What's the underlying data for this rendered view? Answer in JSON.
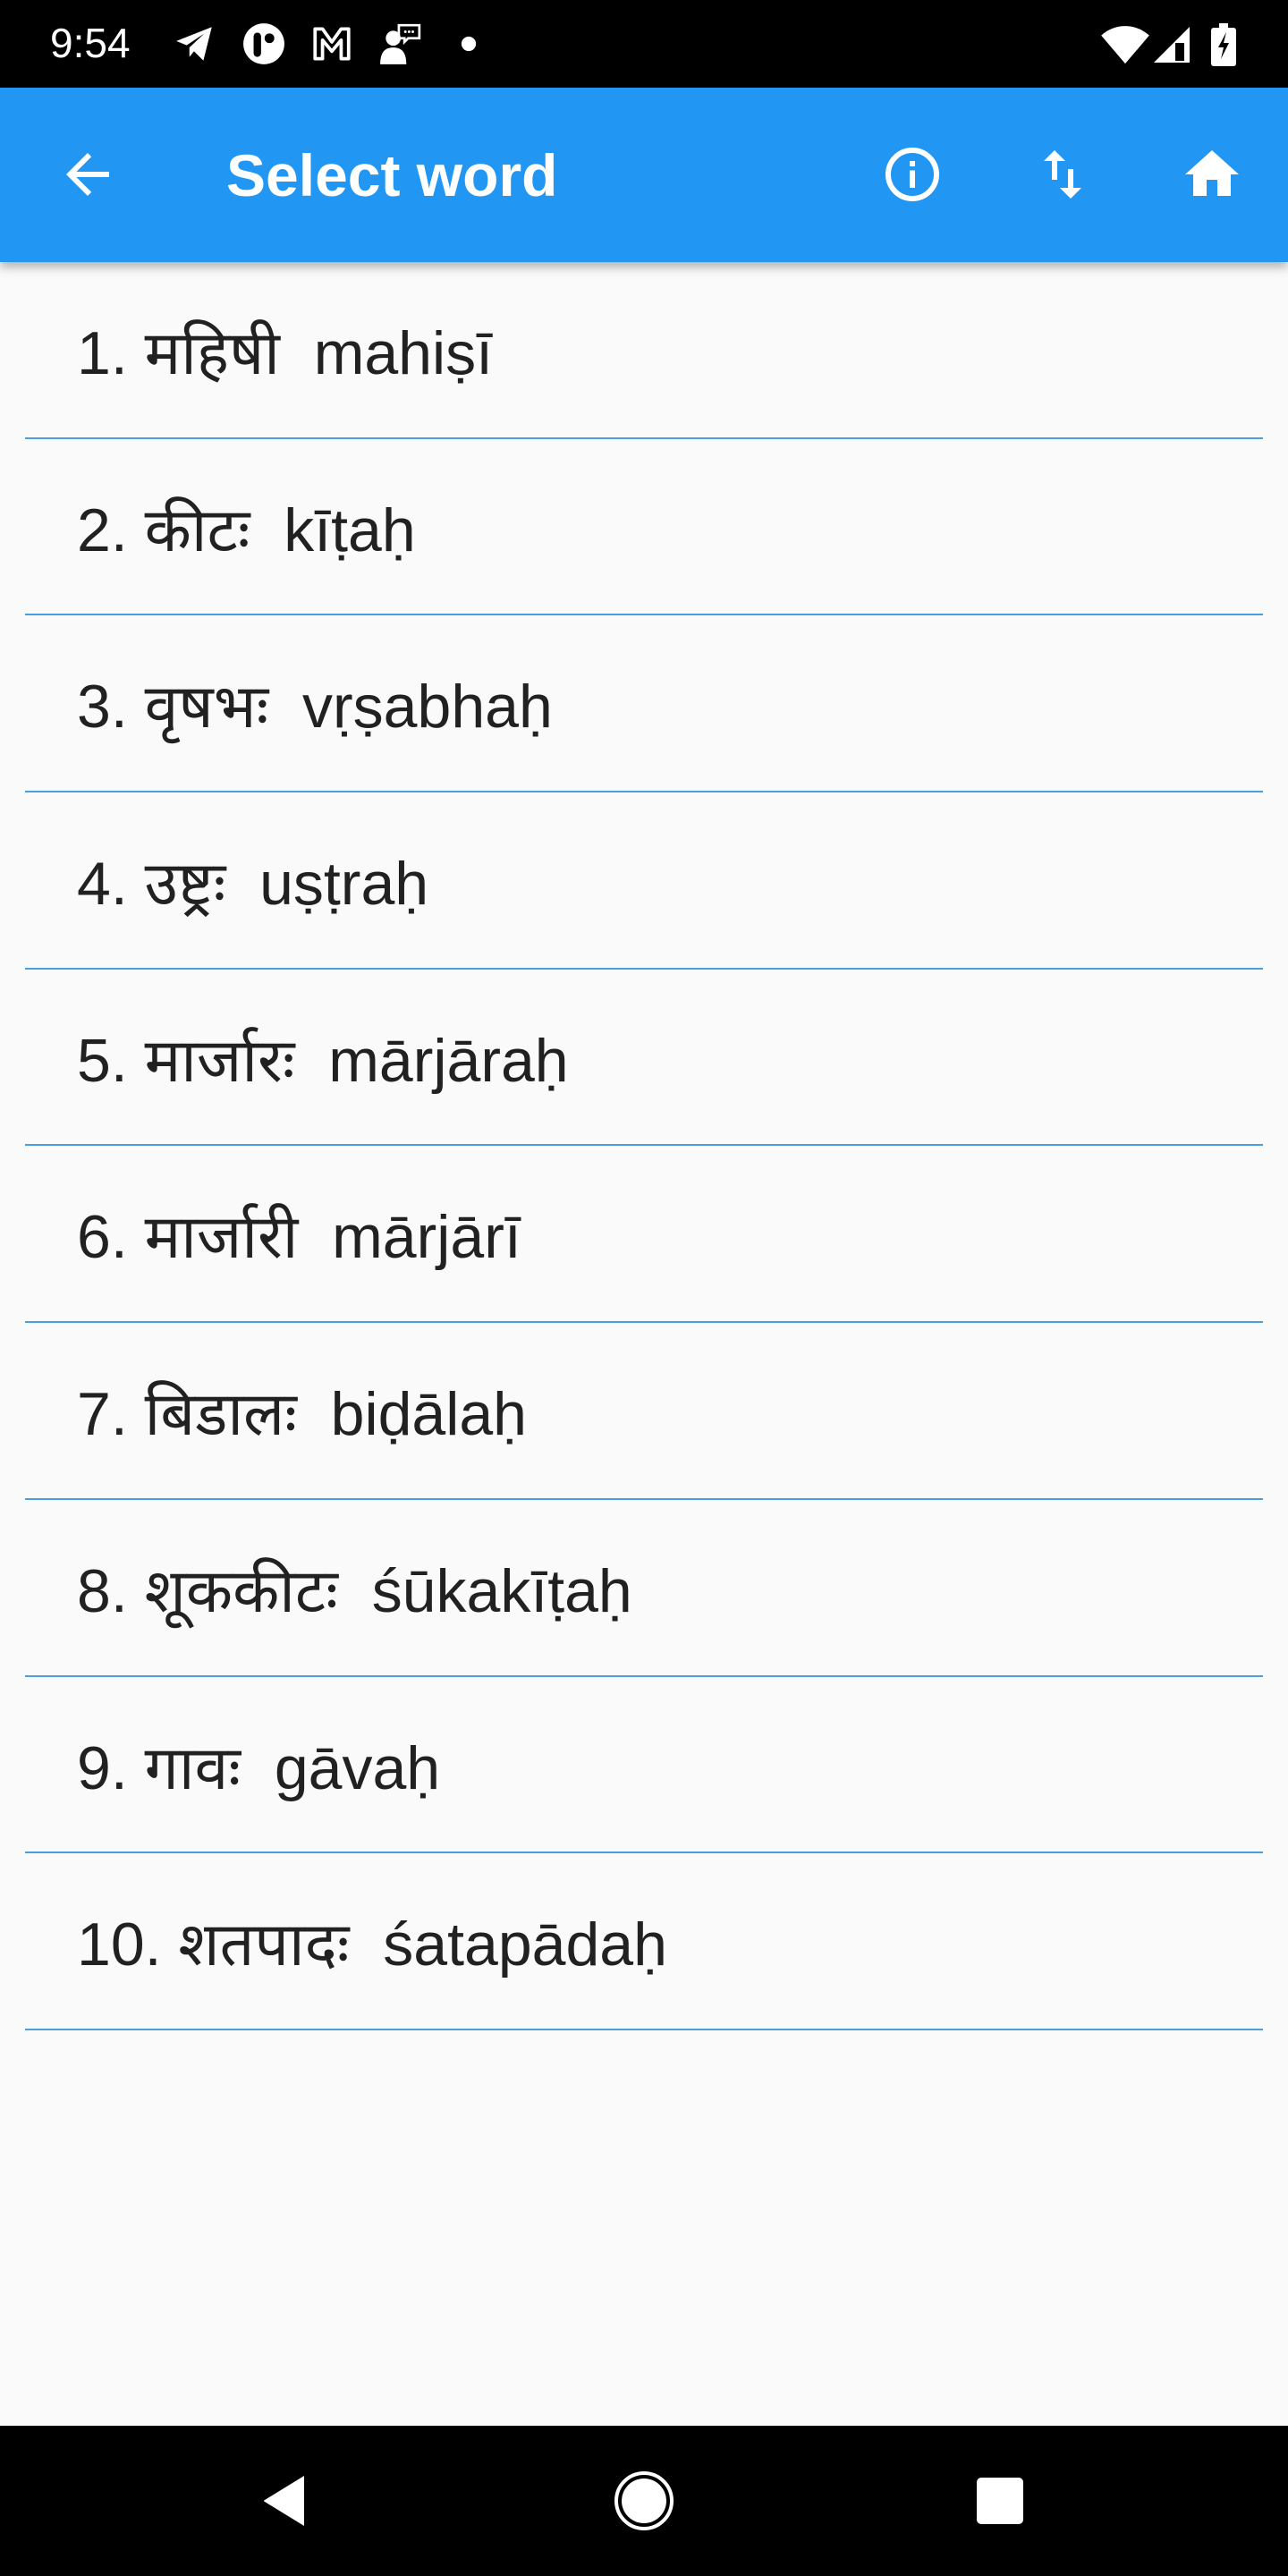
{
  "status_bar": {
    "time": "9:54",
    "notification_icons": [
      "telegram-icon",
      "app-circle-icon",
      "gmail-icon",
      "person-chat-icon",
      "more-dot-icon"
    ],
    "system_icons": [
      "wifi-icon",
      "cell-signal-icon",
      "battery-charging-icon"
    ]
  },
  "app_bar": {
    "title": "Select word",
    "back_icon": "arrow-back-icon",
    "actions": [
      "info-icon",
      "swap-vert-icon",
      "home-icon"
    ],
    "color": "#2196F3"
  },
  "words": [
    {
      "label": "1. महिषी  mahiṣī"
    },
    {
      "label": "2. कीटः  kīṭaḥ"
    },
    {
      "label": "3. वृषभः  vṛṣabhaḥ"
    },
    {
      "label": "4. उष्ट्रः  uṣṭraḥ"
    },
    {
      "label": "5. मार्जारः  mārjāraḥ"
    },
    {
      "label": "6. मार्जारी  mārjārī"
    },
    {
      "label": "7. बिडालः  biḍālaḥ"
    },
    {
      "label": "8. शूककीटः  śūkakīṭaḥ"
    },
    {
      "label": "9. गावः  gāvaḥ"
    },
    {
      "label": "10. शतपादः  śatapādaḥ"
    }
  ],
  "nav_bar": {
    "buttons": [
      "back-triangle-icon",
      "home-circle-icon",
      "recents-square-icon"
    ]
  }
}
